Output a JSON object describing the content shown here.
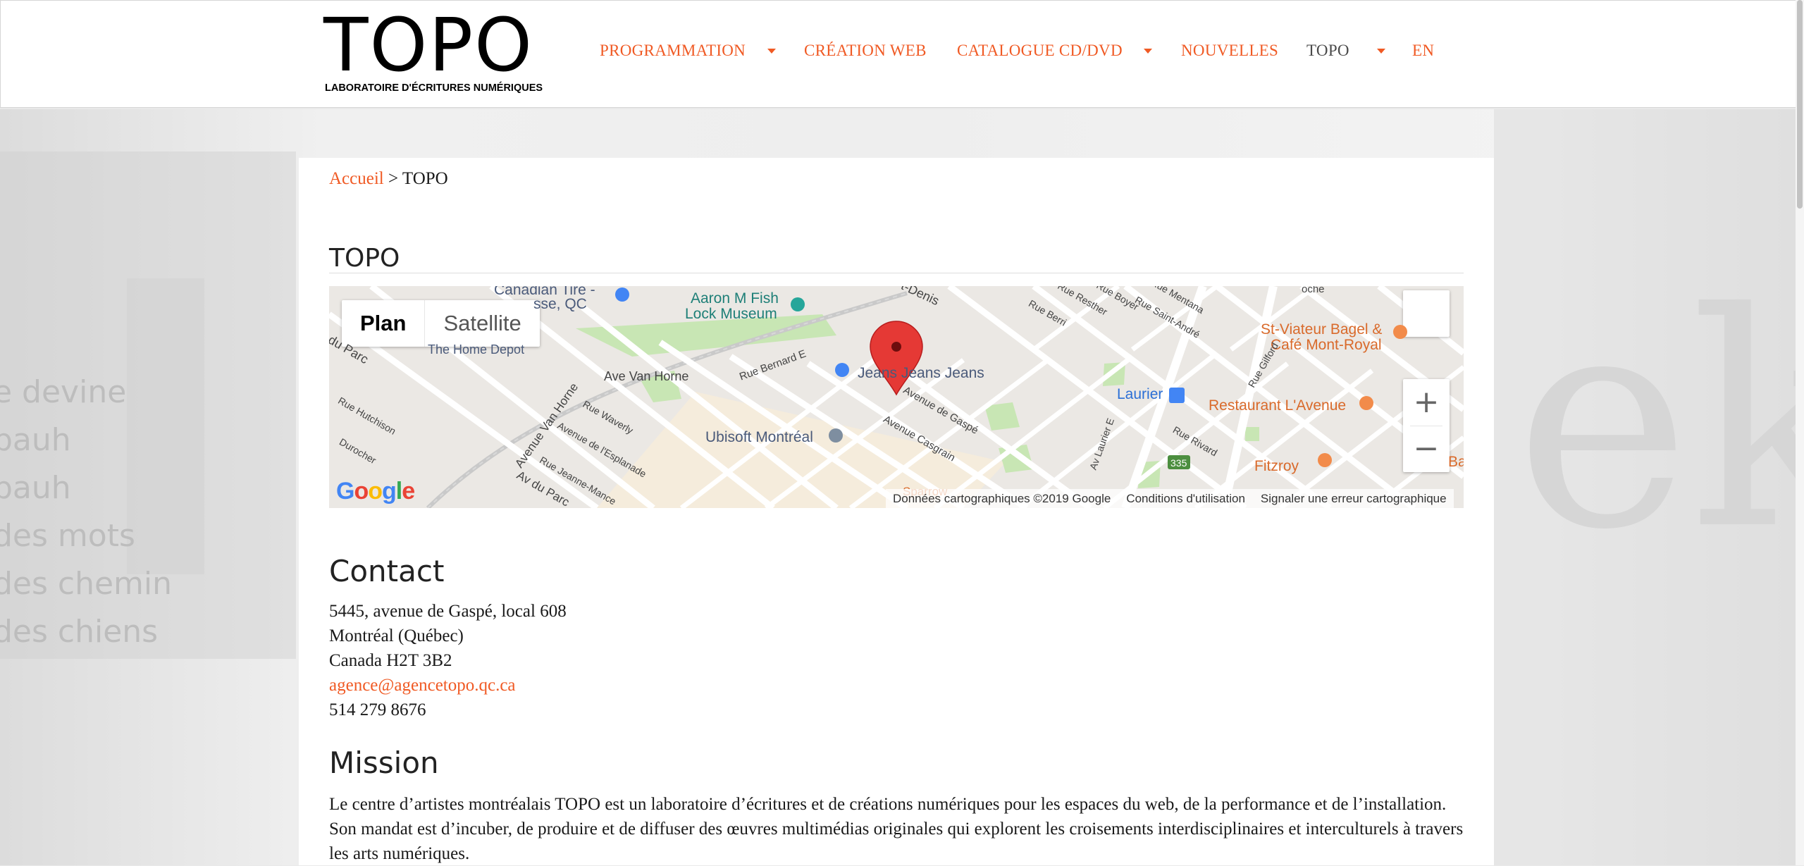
{
  "logo": {
    "word": "TOPO",
    "subtitle": "LABORATOIRE D'ÉCRITURES NUMÉRIQUES"
  },
  "nav": {
    "items": [
      {
        "label": "PROGRAMMATION",
        "has_dropdown": true
      },
      {
        "label": "CRÉATION WEB",
        "has_dropdown": false
      },
      {
        "label": "CATALOGUE CD/DVD",
        "has_dropdown": true
      },
      {
        "label": "NOUVELLES",
        "has_dropdown": false
      },
      {
        "label": "TOPO",
        "has_dropdown": true,
        "active": true
      },
      {
        "label": "EN",
        "has_dropdown": false
      }
    ]
  },
  "breadcrumb": {
    "home": "Accueil",
    "separator": ">",
    "current": "TOPO"
  },
  "page_title": "TOPO",
  "map": {
    "type_buttons": {
      "plan": "Plan",
      "satellite": "Satellite"
    },
    "zoom_in": "+",
    "zoom_out": "−",
    "labels": {
      "canadian_tire": "Canadian Tire -",
      "canadian_tire_2": "sse, QC",
      "aaron_fish": "Aaron M Fish",
      "lock_museum": "Lock Museum",
      "home_depot": "The Home Depot",
      "du_parc": "du Parc",
      "ave_van_horne": "Ave Van Horne",
      "rue_bernard": "Rue Bernard E",
      "jeans": "Jeans Jeans Jeans",
      "st_denis": "t-Denis",
      "ubisoft": "Ubisoft Montréal",
      "laurier": "Laurier",
      "st_viateur": "St-Viateur Bagel &",
      "cafe_mont_royal": "Café Mont-Royal",
      "restaurant_avenue": "Restaurant L'Avenue",
      "fitzroy": "Fitzroy",
      "route_335": "335",
      "rue_hutchison": "Rue Hutchison",
      "durocher": "Durocher",
      "avenue_van_horne": "Avenue Van Horne",
      "rue_waverly": "Rue Waverly",
      "ave_esplanade": "Avenue de l'Esplanade",
      "rue_jeanne_mance": "Rue Jeanne-Mance",
      "av_du_parc": "Av du Parc",
      "avenue_de_gaspe": "Avenue de Gaspé",
      "avenue_casgrain": "Avenue Casgrain",
      "rue_berri": "Rue Berri",
      "rue_saint_andre": "Rue Saint-André",
      "rue_gilford": "Rue Gilford",
      "rue_rivard": "Rue Rivard",
      "av_laurier_e": "Av Laurier E",
      "rue_resther": "Rue Resther",
      "rue_mentana": "Rue Mentana",
      "rue_boyer": "Rue Boyer",
      "sparrow": "Sparrow",
      "ba": "Ba",
      "oche": "oche"
    },
    "google": "Google",
    "footer": {
      "data": "Données cartographiques ©2019 Google",
      "terms": "Conditions d'utilisation",
      "report": "Signaler une erreur cartographique"
    }
  },
  "contact": {
    "title": "Contact",
    "address_line1": "5445, avenue de Gaspé, local 608",
    "address_line2": "Montréal (Québec)",
    "address_line3": "Canada H2T 3B2",
    "email": "agence@agencetopo.qc.ca",
    "phone": "514 279 8676"
  },
  "mission": {
    "title": "Mission",
    "text": "Le centre d’artistes montréalais TOPO est un laboratoire d’écritures et de créations numériques pour les espaces du web, de la performance et de l’installation. Son mandat est d’incuber, de produire et de diffuser des œuvres multimédias originales qui explorent les croisements interdisciplinaires et interculturels à travers les arts numériques."
  },
  "background_text": [
    "e devine",
    "bauh",
    "bauh",
    "des mots",
    "des chemin",
    "des chiens"
  ],
  "colors": {
    "accent": "#f05a24",
    "map_road": "#ffffff",
    "map_park": "#c8e6b4",
    "pin": "#e53935"
  }
}
